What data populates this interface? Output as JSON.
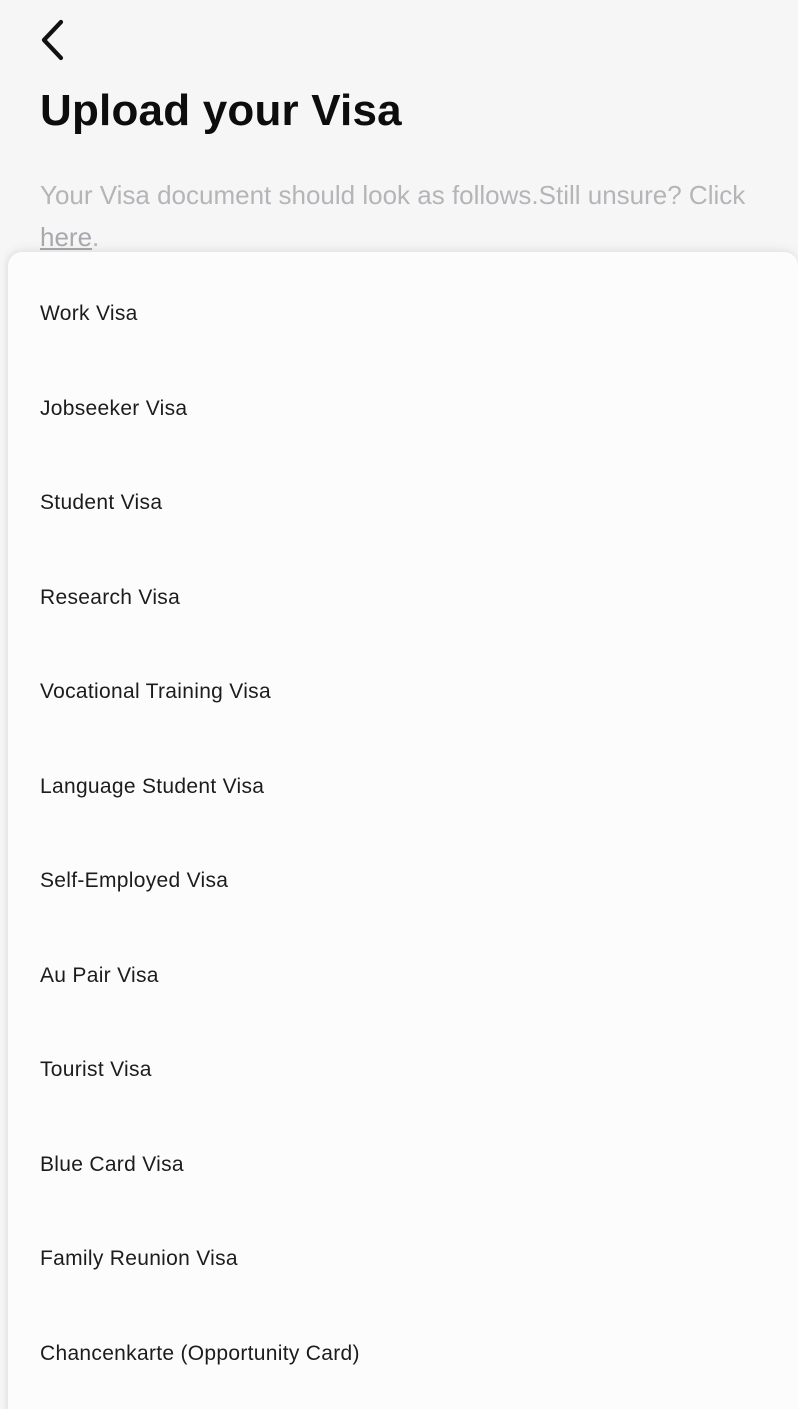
{
  "header": {
    "title": "Upload your Visa",
    "subtitle_text": "Your Visa document should look as follows.Still unsure? Click ",
    "subtitle_link": "here",
    "subtitle_end": "."
  },
  "icons": {
    "back": "chevron-left-icon"
  },
  "visa_options": [
    "Work Visa",
    "Jobseeker Visa",
    "Student Visa",
    "Research Visa",
    "Vocational Training Visa",
    "Language Student Visa",
    "Self-Employed Visa",
    "Au Pair Visa",
    "Tourist Visa",
    "Blue Card Visa",
    "Family Reunion Visa",
    "Chancenkarte (Opportunity Card)"
  ]
}
